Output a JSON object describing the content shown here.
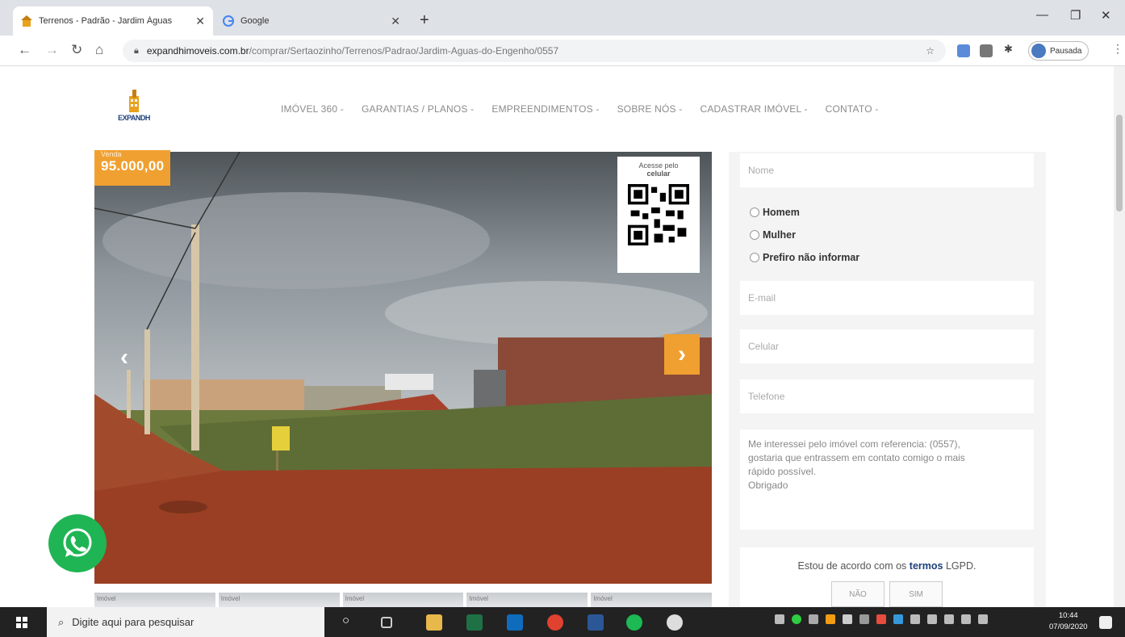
{
  "browser": {
    "tabs": [
      {
        "title": "Terrenos - Padrão - Jardim Águas",
        "active": true
      },
      {
        "title": "Google",
        "active": false
      }
    ],
    "url_host": "expandhimoveis.com.br",
    "url_path": "/comprar/Sertaozinho/Terrenos/Padrao/Jardim-Aguas-do-Engenho/0557",
    "profile_label": "Pausada"
  },
  "site": {
    "logo_text": "EXPANDH",
    "menu": [
      "IMÓVEL 360 -",
      "GARANTIAS / PLANOS -",
      "EMPREENDIMENTOS -",
      "SOBRE NÓS -",
      "CADASTRAR IMÓVEL -",
      "CONTATO -"
    ]
  },
  "listing": {
    "price_label": "Venda",
    "price": "95.000,00",
    "qr_caption_line1": "Acesse pelo",
    "qr_caption_line2": "celular",
    "thumbs": [
      "Imóvel",
      "Imóvel",
      "Imóvel",
      "Imóvel",
      "Imóvel"
    ]
  },
  "form": {
    "name_placeholder": "Nome",
    "gender_options": [
      "Homem",
      "Mulher",
      "Prefiro não informar"
    ],
    "email_placeholder": "E-mail",
    "mobile_placeholder": "Celular",
    "phone_placeholder": "Telefone",
    "message_lines": [
      "Me interessei pelo imóvel com referencia: (0557),",
      "gostaria que entrassem em contato comigo o mais",
      "rápido possível.",
      "Obrigado"
    ],
    "lgpd_prefix": "Estou de acordo com os",
    "lgpd_link": "termos",
    "lgpd_suffix": "LGPD.",
    "btn_no": "NÃO",
    "btn_yes": "SIM"
  },
  "taskbar": {
    "search_placeholder": "Digite aqui para pesquisar",
    "time": "10:44",
    "date": "07/09/2020"
  },
  "colors": {
    "accent": "#f0a030",
    "brand": "#1d3f7a",
    "whatsapp": "#1fb554"
  }
}
